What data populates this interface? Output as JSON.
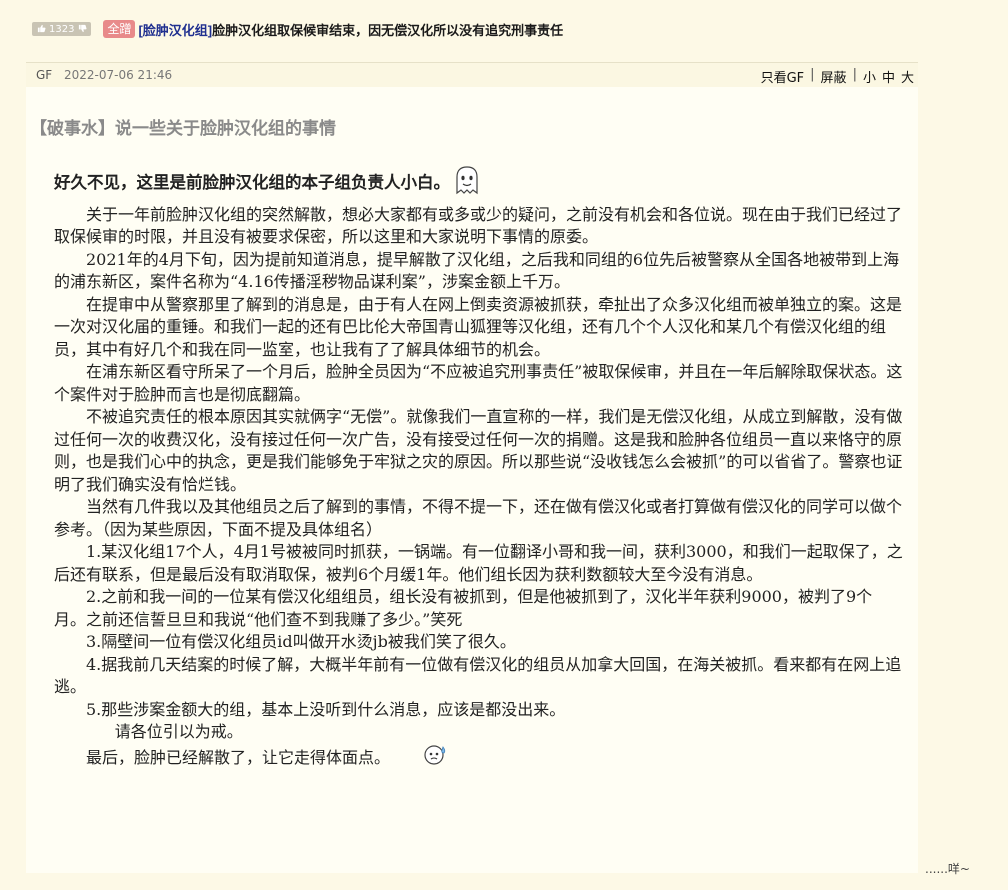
{
  "thread": {
    "vote_count": "1323",
    "badge": "全蹭",
    "title_tag": "[脸肿汉化组]",
    "title_text": "脸肿汉化组取保候审结束，因无偿汉化所以没有追究刑事责任"
  },
  "post": {
    "author": "GF",
    "date": "2022-07-06 21:46",
    "actions": {
      "only_author": "只看GF",
      "block": "屏蔽",
      "font_small": "小",
      "font_medium": "中",
      "font_large": "大"
    },
    "title": "【破事水】说一些关于脸肿汉化组的事情",
    "intro": "好久不见，这里是前脸肿汉化组的本子组负责人小白。",
    "paragraphs": [
      "关于一年前脸肿汉化组的突然解散，想必大家都有或多或少的疑问，之前没有机会和各位说。现在由于我们已经过了取保候审的时限，并且没有被要求保密，所以这里和大家说明下事情的原委。",
      "2021年的4月下旬，因为提前知道消息，提早解散了汉化组，之后我和同组的6位先后被警察从全国各地被带到上海的浦东新区，案件名称为“4.16传播淫秽物品谋利案”，涉案金额上千万。",
      "在提审中从警察那里了解到的消息是，由于有人在网上倒卖资源被抓获，牵扯出了众多汉化组而被单独立的案。这是一次对汉化届的重锤。和我们一起的还有巴比伦大帝国青山狐狸等汉化组，还有几个个人汉化和某几个有偿汉化组的组员，其中有好几个和我在同一监室，也让我有了了解具体细节的机会。",
      "在浦东新区看守所呆了一个月后，脸肿全员因为“不应被追究刑事责任”被取保候审，并且在一年后解除取保状态。这个案件对于脸肿而言也是彻底翻篇。",
      "不被追究责任的根本原因其实就俩字“无偿”。就像我们一直宣称的一样，我们是无偿汉化组，从成立到解散，没有做过任何一次的收费汉化，没有接过任何一次广告，没有接受过任何一次的捐赠。这是我和脸肿各位组员一直以来恪守的原则，也是我们心中的执念，更是我们能够免于牢狱之灾的原因。所以那些说“没收钱怎么会被抓”的可以省省了。警察也证明了我们确实没有恰烂钱。",
      "当然有几件我以及其他组员之后了解到的事情，不得不提一下，还在做有偿汉化或者打算做有偿汉化的同学可以做个参考。（因为某些原因，下面不提及具体组名）",
      "1.某汉化组17个人，4月1号被被同时抓获，一锅端。有一位翻译小哥和我一间，获利3000，和我们一起取保了，之后还有联系，但是最后没有取消取保，被判6个月缓1年。他们组长因为获利数额较大至今没有消息。",
      "2.之前和我一间的一位某有偿汉化组组员，组长没有被抓到，但是他被抓到了，汉化半年获利9000，被判了9个月。之前还信誓旦旦和我说“他们查不到我赚了多少。”笑死",
      "3.隔壁间一位有偿汉化组员id叫做开水烫jb被我们笑了很久。",
      "4.据我前几天结案的时候了解，大概半年前有一位做有偿汉化的组员从加拿大回国，在海关被抓。看来都有在网上追逃。",
      "5.那些涉案金额大的组，基本上没听到什么消息，应该是都没出来。"
    ],
    "warning": "请各位引以为戒。",
    "closing": "最后，脸肿已经解散了，让它走得体面点。"
  },
  "footer": {
    "text": "......咩~"
  }
}
